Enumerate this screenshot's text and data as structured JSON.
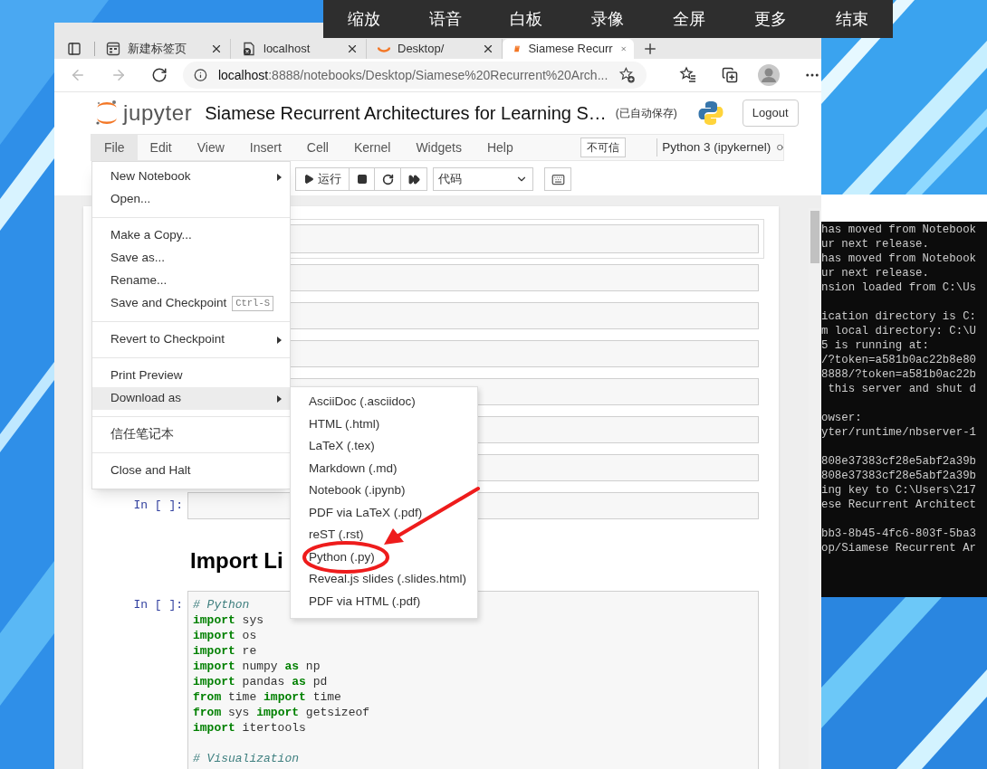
{
  "overlay_toolbar": {
    "items": [
      "缩放",
      "语音",
      "白板",
      "录像",
      "全屏",
      "更多",
      "结束"
    ]
  },
  "browser": {
    "tabs": [
      {
        "title": "新建标签页",
        "kind": "newtab",
        "selected": false
      },
      {
        "title": "localhost",
        "kind": "error",
        "selected": false
      },
      {
        "title": "Desktop/",
        "kind": "jupyter",
        "selected": false
      },
      {
        "title": "Siamese Recurr",
        "kind": "notebook",
        "selected": true
      }
    ],
    "address": {
      "host": "localhost",
      "path": ":8888/notebooks/Desktop/Siamese%20Recurrent%20Arch..."
    }
  },
  "jupyter": {
    "brand": "jupyter",
    "title": "Siamese Recurrent Architectures for Learning S…",
    "save_status": "(已自动保存)",
    "logout": "Logout",
    "menubar": [
      {
        "label": "File",
        "selected": true
      },
      {
        "label": "Edit",
        "selected": false
      },
      {
        "label": "View",
        "selected": false
      },
      {
        "label": "Insert",
        "selected": false
      },
      {
        "label": "Cell",
        "selected": false
      },
      {
        "label": "Kernel",
        "selected": false
      },
      {
        "label": "Widgets",
        "selected": false
      },
      {
        "label": "Help",
        "selected": false
      }
    ],
    "trust_badge": "不可信",
    "kernel": "Python 3 (ipykernel)",
    "toolbar": {
      "run": "运行",
      "cell_type": "代码"
    },
    "file_menu": [
      [
        {
          "label": "New Notebook",
          "submenu": true,
          "selected": false
        },
        {
          "label": "Open...",
          "submenu": false,
          "selected": false
        }
      ],
      [
        {
          "label": "Make a Copy...",
          "submenu": false,
          "selected": false
        },
        {
          "label": "Save as...",
          "submenu": false,
          "selected": false
        },
        {
          "label": "Rename...",
          "submenu": false,
          "selected": false
        },
        {
          "label": "Save and Checkpoint",
          "shortcut": "Ctrl-S",
          "submenu": false,
          "selected": false
        }
      ],
      [
        {
          "label": "Revert to Checkpoint",
          "submenu": true,
          "selected": false
        }
      ],
      [
        {
          "label": "Print Preview",
          "submenu": false,
          "selected": false
        },
        {
          "label": "Download as",
          "submenu": true,
          "selected": true
        }
      ],
      [
        {
          "label": "信任笔记本",
          "submenu": false,
          "selected": false
        }
      ],
      [
        {
          "label": "Close and Halt",
          "submenu": false,
          "selected": false
        }
      ]
    ],
    "download_menu": [
      "AsciiDoc (.asciidoc)",
      "HTML (.html)",
      "LaTeX (.tex)",
      "Markdown (.md)",
      "Notebook (.ipynb)",
      "PDF via LaTeX (.pdf)",
      "reST (.rst)",
      "Python (.py)",
      "Reveal.js slides (.slides.html)",
      "PDF via HTML (.pdf)"
    ],
    "cells": [
      {
        "selected": true
      },
      {
        "selected": false
      },
      {
        "selected": false
      },
      {
        "selected": false
      },
      {
        "selected": false
      },
      {
        "selected": false
      },
      {
        "selected": false
      },
      {
        "prompt": "In [ ]:",
        "selected": false
      }
    ],
    "heading": "Import Li",
    "code_cell": {
      "prompt": "In [ ]:",
      "blocks": [
        [
          [
            {
              "kind": "comment",
              "text": "# Python"
            }
          ],
          [
            {
              "kind": "keyword",
              "text": "import"
            },
            {
              "kind": "name",
              "text": "sys"
            }
          ],
          [
            {
              "kind": "keyword",
              "text": "import"
            },
            {
              "kind": "name",
              "text": "os"
            }
          ],
          [
            {
              "kind": "keyword",
              "text": "import"
            },
            {
              "kind": "name",
              "text": "re"
            }
          ],
          [
            {
              "kind": "keyword",
              "text": "import"
            },
            {
              "kind": "name",
              "text": "numpy"
            },
            {
              "kind": "keyword",
              "text": "as"
            },
            {
              "kind": "name",
              "text": "np"
            }
          ],
          [
            {
              "kind": "keyword",
              "text": "import"
            },
            {
              "kind": "name",
              "text": "pandas"
            },
            {
              "kind": "keyword",
              "text": "as"
            },
            {
              "kind": "name",
              "text": "pd"
            }
          ],
          [
            {
              "kind": "keyword",
              "text": "from"
            },
            {
              "kind": "name",
              "text": "time"
            },
            {
              "kind": "keyword",
              "text": "import"
            },
            {
              "kind": "name",
              "text": "time"
            }
          ],
          [
            {
              "kind": "keyword",
              "text": "from"
            },
            {
              "kind": "name",
              "text": "sys"
            },
            {
              "kind": "keyword",
              "text": "import"
            },
            {
              "kind": "name",
              "text": "getsizeof"
            }
          ],
          [
            {
              "kind": "keyword",
              "text": "import"
            },
            {
              "kind": "name",
              "text": "itertools"
            }
          ]
        ],
        [
          [
            {
              "kind": "comment",
              "text": "# Visualization"
            }
          ]
        ]
      ]
    }
  },
  "terminal": {
    "blocks": [
      [
        "has moved from Notebook",
        "ur next release.",
        "has moved from Notebook",
        "ur next release.",
        "nsion loaded from C:\\Us"
      ],
      [
        "ication directory is C:",
        "m local directory: C:\\U",
        "5 is running at:",
        "/?token=a581b0ac22b8e80",
        "8888/?token=a581b0ac22b",
        " this server and shut d"
      ],
      [
        "owser:",
        "yter/runtime/nbserver-1"
      ],
      [
        "808e37383cf28e5abf2a39b",
        "808e37383cf28e5abf2a39b",
        "ing key to C:\\Users\\217",
        "ese Recurrent Architect"
      ],
      [
        "bb3-8b45-4fc6-803f-5ba3",
        "op/Siamese Recurrent Ar"
      ]
    ]
  }
}
